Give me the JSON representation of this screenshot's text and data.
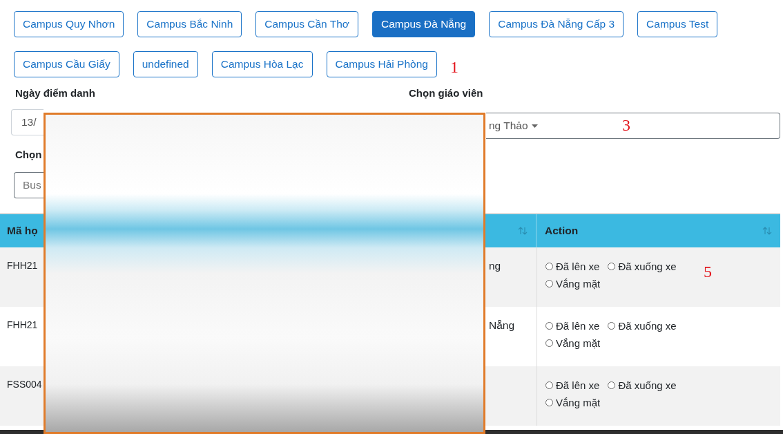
{
  "campuses": [
    {
      "label": "Campus Quy Nhơn",
      "selected": false
    },
    {
      "label": "Campus Bắc Ninh",
      "selected": false
    },
    {
      "label": "Campus Cần Thơ",
      "selected": false
    },
    {
      "label": "Campus Đà Nẵng",
      "selected": true
    },
    {
      "label": "Campus Đà Nẵng Cấp 3",
      "selected": false
    },
    {
      "label": "Campus Test",
      "selected": false
    },
    {
      "label": "Campus Cầu Giấy",
      "selected": false
    },
    {
      "label": "undefined",
      "selected": false
    },
    {
      "label": "Campus Hòa Lạc",
      "selected": false
    },
    {
      "label": "Campus Hải Phòng",
      "selected": false
    }
  ],
  "date_field": {
    "label": "Ngày điểm danh",
    "value": "13/"
  },
  "teacher_field": {
    "label": "Chọn giáo viên",
    "value": "ng Thảo"
  },
  "bus_field": {
    "label": "Chọn",
    "placeholder": "Bus"
  },
  "table": {
    "columns": [
      {
        "label": "Mã họ"
      },
      {
        "sortable": true
      },
      {
        "label": "Action",
        "sortable": true
      }
    ],
    "rows": [
      {
        "column_1": "FHH21",
        "column_3": "ng",
        "options": [
          {
            "label": "Đã lên xe",
            "selected": false
          },
          {
            "label": "Đã xuống xe",
            "selected": false
          },
          {
            "label": "Vắng mặt",
            "selected": false
          }
        ]
      },
      {
        "column_1": "FHH21",
        "column_3": "Nẵng",
        "options": [
          {
            "label": "Đã lên xe",
            "selected": false
          },
          {
            "label": "Đã xuống xe",
            "selected": false
          },
          {
            "label": "Vắng mặt",
            "selected": false
          }
        ]
      },
      {
        "column_1": "FSS004",
        "options": [
          {
            "label": "Đã lên xe",
            "selected": false
          },
          {
            "label": "Đã xuống xe",
            "selected": false
          },
          {
            "label": "Vắng mặt",
            "selected": false
          }
        ]
      }
    ]
  },
  "annotations": [
    {
      "text": "1"
    },
    {
      "text": "3"
    },
    {
      "text": "5"
    }
  ]
}
